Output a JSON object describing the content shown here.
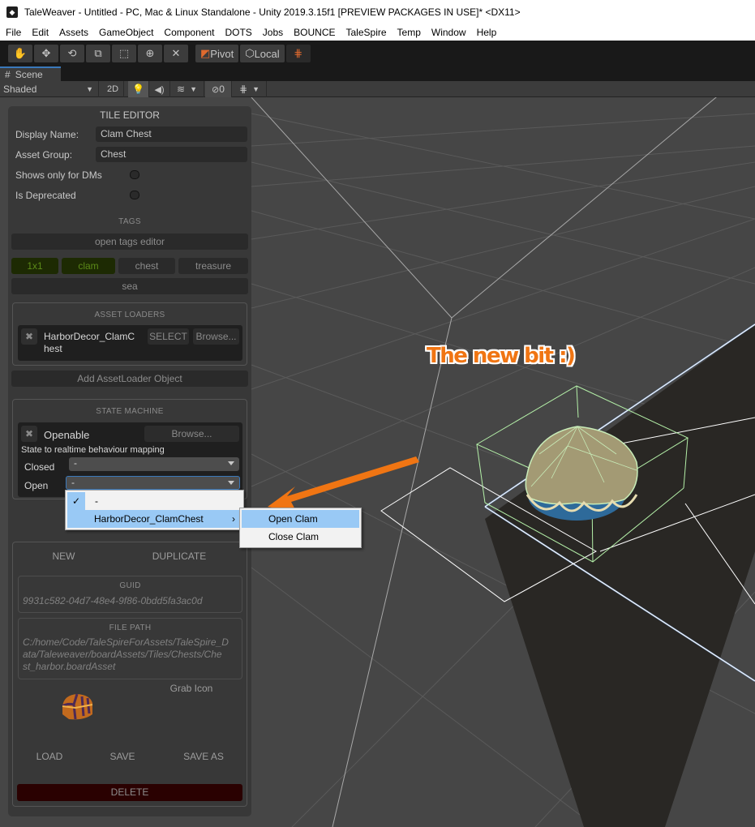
{
  "window": {
    "title": "TaleWeaver - Untitled - PC, Mac & Linux Standalone - Unity 2019.3.15f1 [PREVIEW PACKAGES IN USE]* <DX11>"
  },
  "menu": [
    "File",
    "Edit",
    "Assets",
    "GameObject",
    "Component",
    "DOTS",
    "Jobs",
    "BOUNCE",
    "TaleSpire",
    "Temp",
    "Window",
    "Help"
  ],
  "toolbar": {
    "tools": [
      "hand-tool",
      "move-tool",
      "rotate-tool",
      "scale-tool",
      "rect-tool",
      "transform-tool",
      "custom-tool"
    ],
    "pivot_label": "Pivot",
    "local_label": "Local"
  },
  "scene_tab": {
    "label": "Scene",
    "shading_mode": "Shaded",
    "mode_2d": "2D",
    "hidden_count": "0"
  },
  "tile_editor": {
    "title": "TILE EDITOR",
    "display_name_label": "Display Name:",
    "display_name_value": "Clam Chest",
    "asset_group_label": "Asset Group:",
    "asset_group_value": "Chest",
    "dm_only_label": "Shows only for DMs",
    "dm_only_value": false,
    "deprecated_label": "Is Deprecated",
    "deprecated_value": false,
    "tags_heading": "TAGS",
    "open_tags_editor": "open tags editor",
    "tags": [
      {
        "label": "1x1",
        "active": true
      },
      {
        "label": "clam",
        "active": true
      },
      {
        "label": "chest",
        "active": false
      },
      {
        "label": "treasure",
        "active": false
      },
      {
        "label": "sea",
        "active": false
      }
    ],
    "asset_loaders": {
      "heading": "ASSET LOADERS",
      "items": [
        {
          "name_line1": "HarborDecor_ClamC",
          "name_line2": "hest",
          "select_label": "SELECT",
          "browse_label": "Browse..."
        }
      ],
      "add_label": "Add AssetLoader Object"
    },
    "state_machine": {
      "heading": "STATE MACHINE",
      "name": "Openable",
      "browse_label": "Browse...",
      "mapping_label": "State to realtime behaviour mapping",
      "states": [
        {
          "label": "Closed",
          "value": "-"
        },
        {
          "label": "Open",
          "value": "-"
        }
      ]
    },
    "dropdown_menu": {
      "items": [
        "-",
        "HarborDecor_ClamChest"
      ],
      "checked": "-",
      "submenu": [
        "Open Clam",
        "Close Clam"
      ],
      "highlighted_submenu": "Open Clam"
    },
    "new_label": "NEW",
    "duplicate_label": "DUPLICATE",
    "guid_heading": "GUID",
    "guid_value": "9931c582-04d7-48e4-9f86-0bdd5fa3ac0d",
    "file_path_heading": "FILE PATH",
    "file_path_lines": [
      "C:/home/Code/TaleSpireForAssets/TaleSpire_D",
      "ata/Taleweaver/boardAssets/Tiles/Chests/Che",
      "st_harbor.boardAsset"
    ],
    "grab_icon_label": "Grab Icon",
    "load_label": "LOAD",
    "save_label": "SAVE",
    "save_as_label": "SAVE AS",
    "delete_label": "DELETE"
  },
  "annotation": {
    "text": "The new bit :)",
    "color": "#f07513"
  },
  "colors": {
    "panel_bg": "#383838",
    "tag_active_bg": "#1d2a03",
    "tag_active_text": "#5c8a18",
    "delete_bg": "#2a0101",
    "menu_highlight": "#99c9f5",
    "selection_wire": "#b4f0a8",
    "focus_blue": "#3a79bb"
  }
}
